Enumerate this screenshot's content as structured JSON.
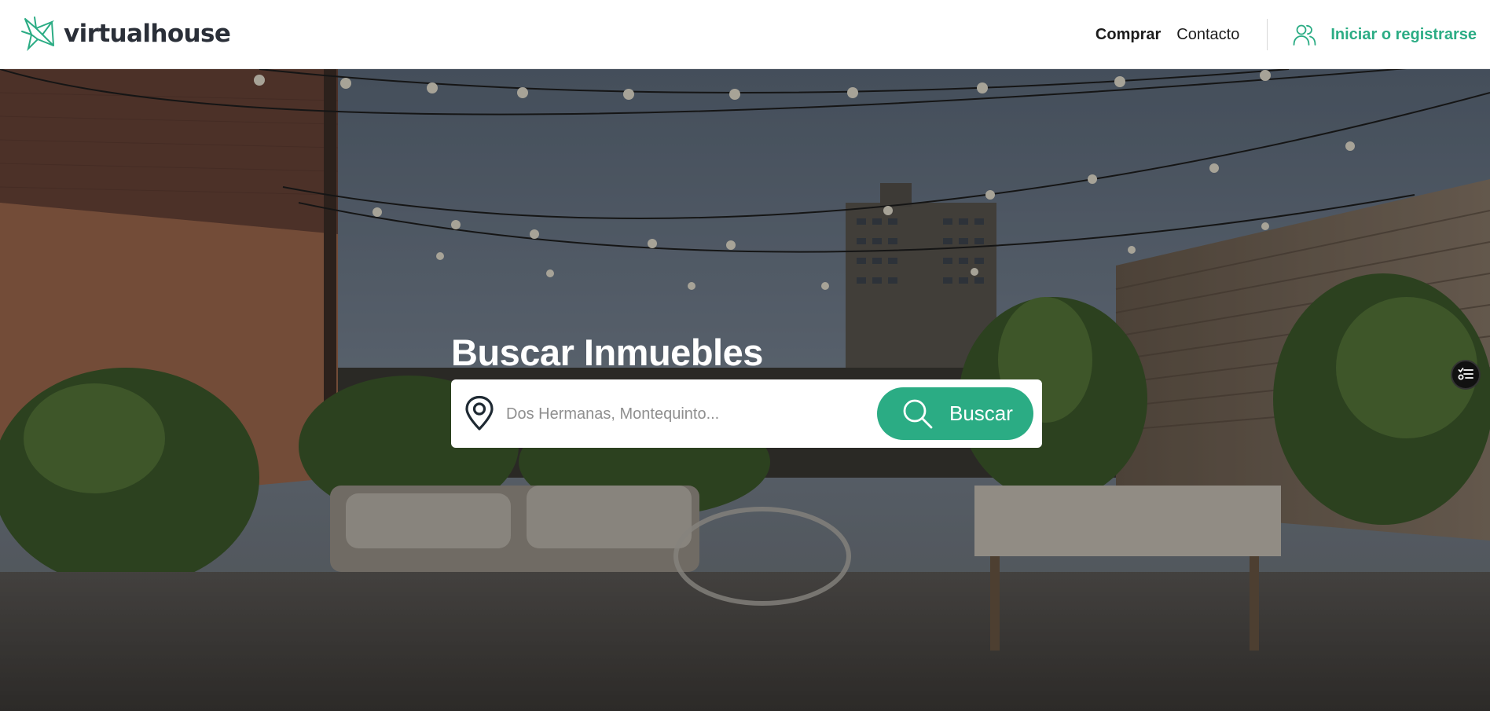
{
  "brand": {
    "name": "virtualhouse",
    "logo_icon": "star-network-icon",
    "accent_color": "#2bac84"
  },
  "nav": {
    "buy_label": "Comprar",
    "contact_label": "Contacto",
    "login_label": "Iniciar o registrarse",
    "login_icon": "users-icon"
  },
  "hero": {
    "title": "Buscar Inmuebles",
    "background": "rooftop-terrace-photo",
    "search": {
      "placeholder": "Dos Hermanas, Montequinto...",
      "value": "",
      "location_icon": "map-pin-icon",
      "button_label": "Buscar",
      "button_icon": "search-icon"
    }
  },
  "side_widget": {
    "icon": "filter-list-icon"
  }
}
